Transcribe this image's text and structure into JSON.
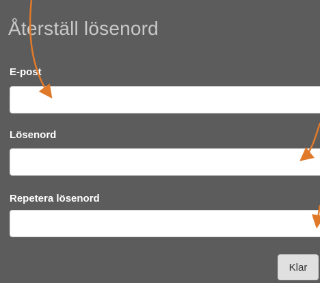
{
  "dialog": {
    "title": "Återställ lösenord",
    "fields": [
      {
        "label": "E-post",
        "value": "",
        "placeholder": ""
      },
      {
        "label": "Lösenord",
        "value": "",
        "placeholder": ""
      },
      {
        "label": "Repetera lösenord",
        "value": "",
        "placeholder": ""
      }
    ],
    "done_label": "Klar"
  },
  "annotations": {
    "arrow_color": "#e07a2a"
  }
}
